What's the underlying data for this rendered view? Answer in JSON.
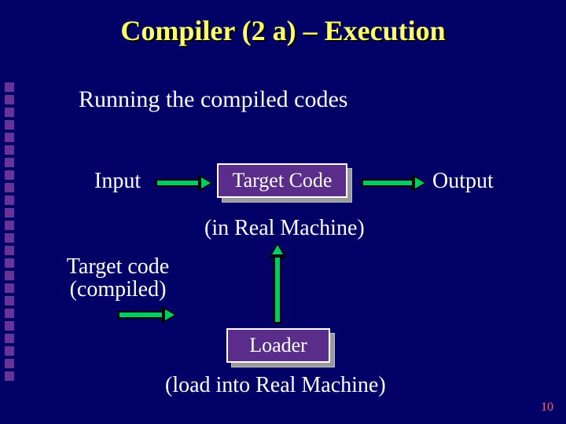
{
  "title": "Compiler (2 a) – Execution",
  "subtitle": "Running the compiled codes",
  "labels": {
    "input": "Input",
    "output": "Output",
    "real_machine": "(in Real Machine)",
    "target_compiled_line1": "Target code",
    "target_compiled_line2": "(compiled)",
    "load_into": "(load into Real Machine)"
  },
  "boxes": {
    "target_code": "Target Code",
    "loader": "Loader"
  },
  "page_number": "10",
  "chart_data": {
    "type": "diagram",
    "nodes": [
      {
        "id": "input",
        "label": "Input",
        "kind": "text"
      },
      {
        "id": "target_code",
        "label": "Target Code",
        "kind": "box",
        "note": "(in Real Machine)"
      },
      {
        "id": "output",
        "label": "Output",
        "kind": "text"
      },
      {
        "id": "target_compiled",
        "label": "Target code (compiled)",
        "kind": "text"
      },
      {
        "id": "loader",
        "label": "Loader",
        "kind": "box",
        "note": "(load into Real Machine)"
      }
    ],
    "edges": [
      {
        "from": "input",
        "to": "target_code",
        "dir": "right"
      },
      {
        "from": "target_code",
        "to": "output",
        "dir": "right"
      },
      {
        "from": "target_compiled",
        "to": "loader",
        "dir": "right",
        "implied": true
      },
      {
        "from": "loader",
        "to": "target_code",
        "dir": "up"
      }
    ]
  }
}
